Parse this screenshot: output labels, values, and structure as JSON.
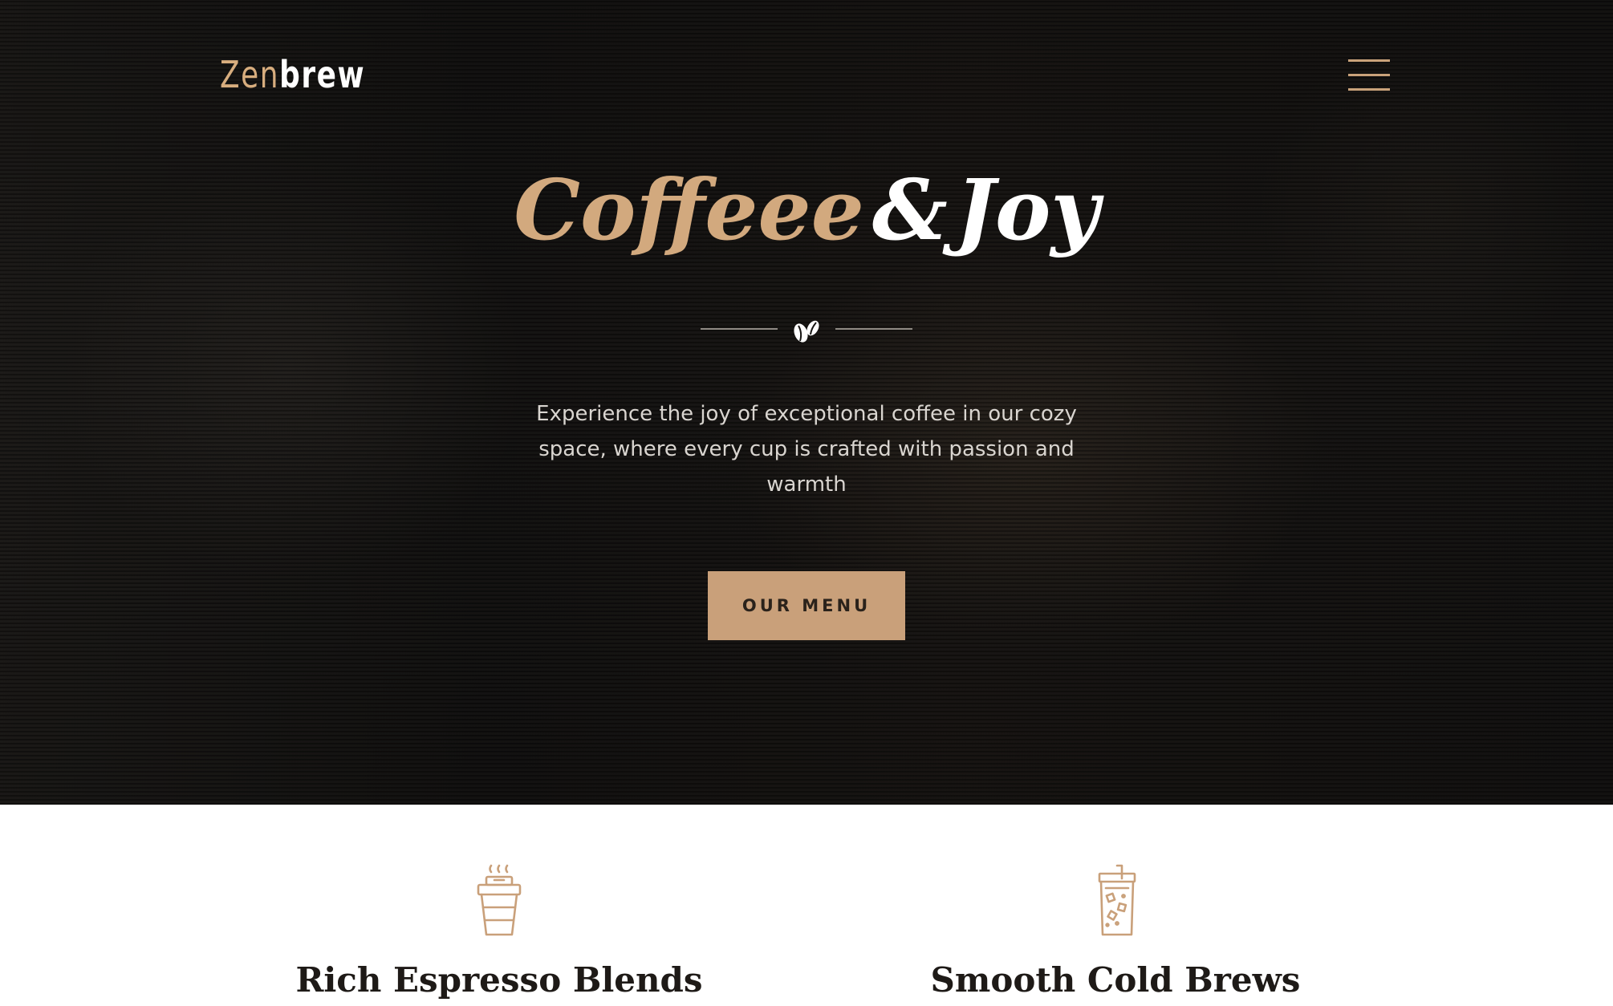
{
  "header": {
    "logo_part1": "Zen",
    "logo_part2": "brew",
    "menu_icon": "hamburger-menu-icon"
  },
  "hero": {
    "title_accent": "Coffeee",
    "title_amp": "&",
    "title_main": "Joy",
    "divider_icon": "coffee-beans-icon",
    "description": "Experience the joy of exceptional coffee in our cozy space, where every cup is crafted with passion and warmth",
    "cta_label": "OUR MENU"
  },
  "features": [
    {
      "icon": "takeaway-cup-icon",
      "title": "Rich Espresso Blends"
    },
    {
      "icon": "iced-drink-icon",
      "title": "Smooth Cold Brews"
    }
  ],
  "colors": {
    "accent": "#c9a07a",
    "hero_background": "#161412",
    "text_light": "#d9d5d0",
    "heading_dark": "#1e1a17"
  }
}
